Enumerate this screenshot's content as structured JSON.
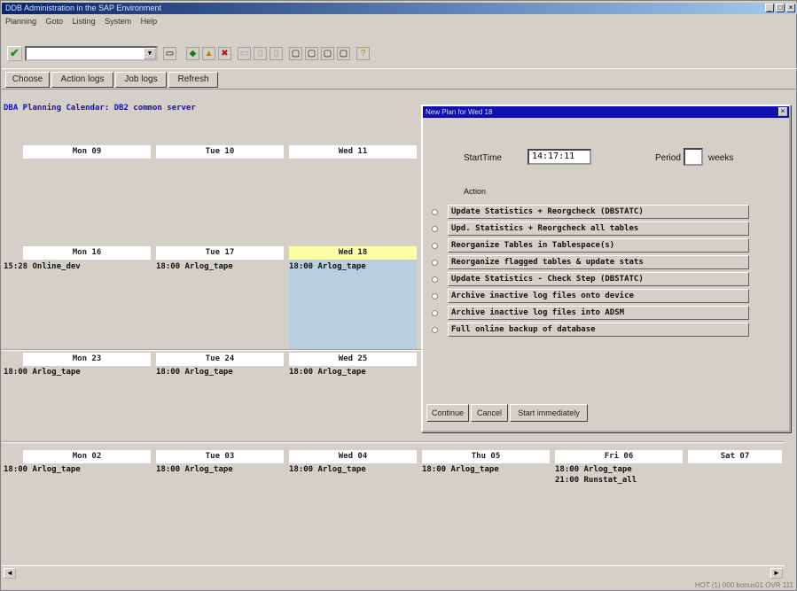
{
  "window": {
    "title": "DDB Administration in the SAP Environment"
  },
  "menubar": {
    "items": [
      "Planning",
      "Goto",
      "Listing",
      "System",
      "Help"
    ]
  },
  "toolbar": {
    "command_value": ""
  },
  "appbar": {
    "buttons": [
      "Choose",
      "Action logs",
      "Job logs",
      "Refresh"
    ]
  },
  "calendar": {
    "heading": "DBA Planning Calendar: DB2 common server",
    "weeks": [
      {
        "days": [
          {
            "label": "Mon 09",
            "entries": []
          },
          {
            "label": "Tue 10",
            "entries": []
          },
          {
            "label": "Wed 11",
            "entries": []
          }
        ]
      },
      {
        "days": [
          {
            "label": "Mon 16",
            "entries": [
              "15:28 Online_dev"
            ]
          },
          {
            "label": "Tue 17",
            "entries": [
              "18:00 Arlog_tape"
            ]
          },
          {
            "label": "Wed 18",
            "entries": [
              "18:00 Arlog_tape"
            ]
          }
        ]
      },
      {
        "days": [
          {
            "label": "Mon 23",
            "entries": [
              "18:00 Arlog_tape"
            ]
          },
          {
            "label": "Tue 24",
            "entries": [
              "18:00 Arlog_tape"
            ]
          },
          {
            "label": "Wed 25",
            "entries": [
              "18:00 Arlog_tape"
            ]
          }
        ]
      },
      {
        "days": [
          {
            "label": "Mon 02",
            "entries": [
              "18:00 Arlog_tape"
            ]
          },
          {
            "label": "Tue 03",
            "entries": [
              "18:00 Arlog_tape"
            ]
          },
          {
            "label": "Wed 04",
            "entries": [
              "18:00 Arlog_tape"
            ]
          },
          {
            "label": "Thu 05",
            "entries": [
              "18:00 Arlog_tape"
            ]
          },
          {
            "label": "Fri 06",
            "entries": [
              "18:00 Arlog_tape",
              "21:00 Runstat_all"
            ]
          },
          {
            "label": "Sat 07",
            "entries": []
          }
        ]
      }
    ]
  },
  "dialog": {
    "title": "New Plan for Wed 18",
    "start_time_label": "StartTime",
    "start_time_value": "14:17:11",
    "period_label": "Period",
    "period_value": "",
    "period_unit": "weeks",
    "action_label": "Action",
    "actions": [
      "Update Statistics + Reorgcheck (DBSTATC)",
      "Upd. Statistics + Reorgcheck all tables",
      "Reorganize Tables in Tablespace(s)",
      "Reorganize flagged tables & update stats",
      "Update Statistics - Check Step (DBSTATC)",
      "Archive inactive log files onto device",
      "Archive inactive log files into ADSM",
      "Full online backup of database"
    ],
    "buttons": {
      "continue": "Continue",
      "cancel": "Cancel",
      "start": "Start immediately"
    }
  },
  "statusbar": {
    "system": "HOT (1) 000   bonus01   OVR 111"
  },
  "colors": {
    "title_bar": "#08246b",
    "selected_day": "#ffffa8",
    "selected_cell": "#b7cee0",
    "heading_text": "#1010c0"
  }
}
